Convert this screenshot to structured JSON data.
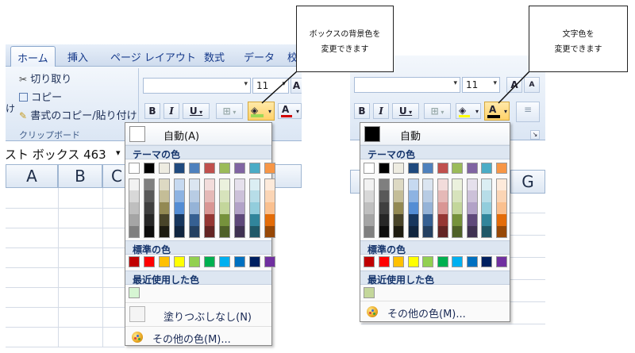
{
  "left_ribbon": {
    "tabs": [
      "ホーム",
      "挿入",
      "ページ レイアウト",
      "数式",
      "データ",
      "校"
    ],
    "clipboard": {
      "cut": "切り取り",
      "copy": "コピー",
      "format_painter": "書式のコピー/貼り付け",
      "group_label": "クリップボード",
      "paste_fragment": "け"
    },
    "font_size": "11",
    "font_size_next": "A",
    "bold": "B",
    "italic": "I",
    "underline": "U",
    "font_color_glyph": "A"
  },
  "name_box": "スト ボックス 463",
  "left_columns": [
    "A",
    "B",
    "C"
  ],
  "right_columns": [
    "G"
  ],
  "fill_palette": {
    "auto_label": "自動(A)",
    "theme_heading": "テーマの色",
    "standard_heading": "標準の色",
    "recent_heading": "最近使用した色",
    "no_fill_label": "塗りつぶしなし(N)",
    "more_colors_label": "その他の色(M)...",
    "recent_color": "#d6f5d3"
  },
  "font_palette": {
    "auto_label": "自動",
    "theme_heading": "テーマの色",
    "standard_heading": "標準の色",
    "recent_heading": "最近使用した色",
    "more_colors_label": "その他の色(M)...",
    "recent_color": "#c4d79b"
  },
  "right_ribbon": {
    "font_size": "11",
    "grow_glyph": "A",
    "shrink_glyph": "A",
    "bold": "B",
    "italic": "I",
    "underline": "U",
    "font_color_glyph": "A"
  },
  "theme_colors": {
    "top": [
      "#ffffff",
      "#000000",
      "#eeece1",
      "#1f497d",
      "#4f81bd",
      "#c0504d",
      "#9bbb59",
      "#8064a2",
      "#4bacc6",
      "#f79646"
    ],
    "shades": [
      [
        "#f2f2f2",
        "#d8d8d8",
        "#bfbfbf",
        "#a5a5a5",
        "#7f7f7f"
      ],
      [
        "#7f7f7f",
        "#595959",
        "#3f3f3f",
        "#262626",
        "#0c0c0c"
      ],
      [
        "#ddd9c3",
        "#c4bd97",
        "#938953",
        "#494429",
        "#1d1b10"
      ],
      [
        "#c6d9f0",
        "#8db3e2",
        "#548dd4",
        "#17365d",
        "#0f243e"
      ],
      [
        "#dbe5f1",
        "#b8cce4",
        "#95b3d7",
        "#366092",
        "#244061"
      ],
      [
        "#f2dcdb",
        "#e5b9b7",
        "#d99694",
        "#953734",
        "#632423"
      ],
      [
        "#ebf1dd",
        "#d7e3bc",
        "#c3d69b",
        "#76923c",
        "#4f6128"
      ],
      [
        "#e5e0ec",
        "#ccc1d9",
        "#b2a2c7",
        "#5f497a",
        "#3f3151"
      ],
      [
        "#dbeef3",
        "#b7dde8",
        "#92cddc",
        "#31859b",
        "#205867"
      ],
      [
        "#fdeada",
        "#fbd5b5",
        "#fac08f",
        "#e36c09",
        "#974806"
      ]
    ]
  },
  "standard_colors": [
    "#c00000",
    "#ff0000",
    "#ffc000",
    "#ffff00",
    "#92d050",
    "#00b050",
    "#00b0f0",
    "#0070c0",
    "#002060",
    "#7030a0"
  ],
  "callouts": {
    "fill": [
      "ボックスの背景色を",
      "変更できます"
    ],
    "font": [
      "文字色を",
      "変更できます"
    ]
  }
}
